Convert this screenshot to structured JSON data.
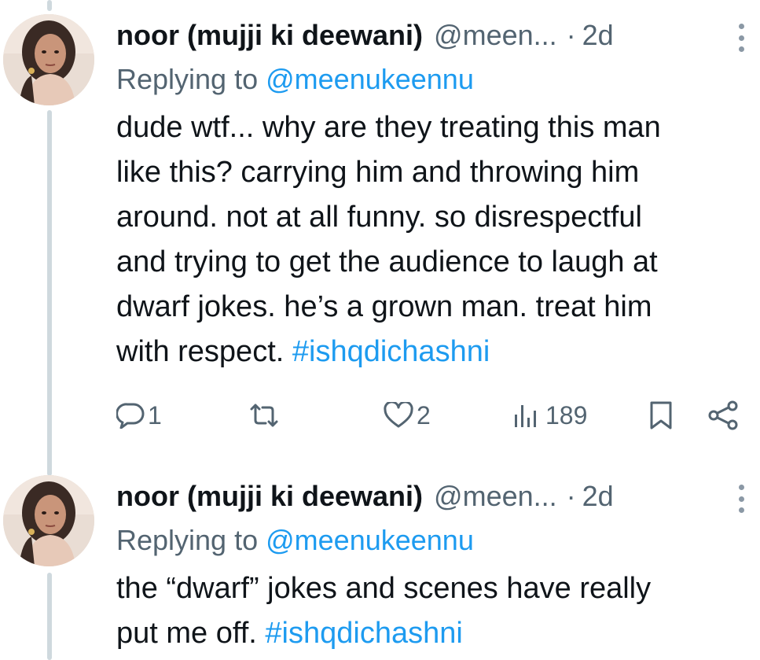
{
  "tweets": [
    {
      "display_name": "noor (mujji ki deewani)",
      "handle": "@meen...",
      "separator": "·",
      "time": "2d",
      "replying_to_label": "Replying to",
      "replying_to_mention": "@meenukeennu",
      "body_lines": [
        "dude wtf... why are they treating this man",
        "like this? carrying him and throwing him",
        "around. not at all funny. so disrespectful",
        "and trying to get the audience to laugh at",
        "dwarf jokes. he’s a grown man. treat him"
      ],
      "body_last_text": "with respect.",
      "hashtag": "#ishqdichashni",
      "actions": {
        "replies": "1",
        "retweets": "",
        "likes": "2",
        "views": "189"
      }
    },
    {
      "display_name": "noor (mujji ki deewani)",
      "handle": "@meen...",
      "separator": "·",
      "time": "2d",
      "replying_to_label": "Replying to",
      "replying_to_mention": "@meenukeennu",
      "body_lines": [
        "the “dwarf” jokes and scenes have really"
      ],
      "body_last_text": "put me off.",
      "hashtag": "#ishqdichashni"
    }
  ],
  "icons": {
    "reply": "reply-icon",
    "retweet": "retweet-icon",
    "like": "heart-icon",
    "views": "views-icon",
    "bookmark": "bookmark-icon",
    "share": "share-icon",
    "more": "more-options-icon"
  },
  "colors": {
    "link": "#1d9bf0",
    "secondary_text": "#536471",
    "primary_text": "#0f1419",
    "thread_line": "#cfd9de"
  }
}
